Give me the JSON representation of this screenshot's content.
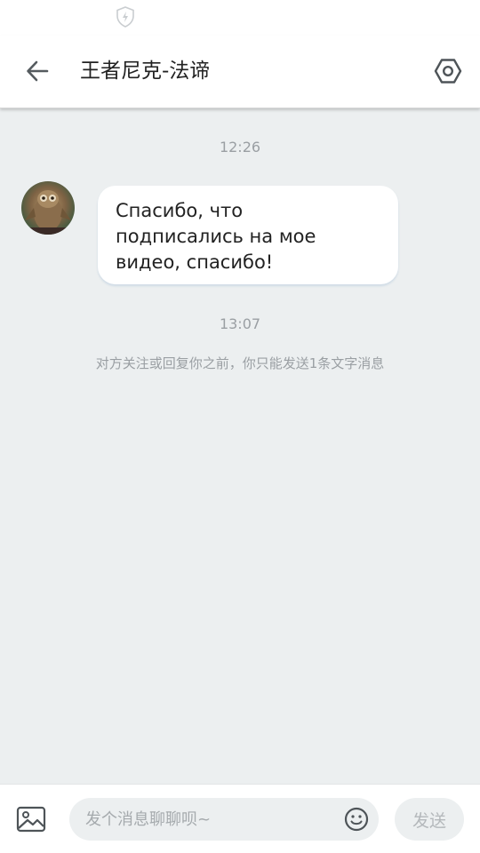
{
  "status_bar": {
    "icon": "shield-bolt-icon"
  },
  "header": {
    "back_icon": "arrow-left-icon",
    "title": "王者尼克-法谛",
    "settings_icon": "hexagon-settings-icon"
  },
  "messages": [
    {
      "time": "12:26",
      "sender": "other",
      "avatar": "owl-avatar",
      "lines": [
        "Спасибо, что",
        "подписались на мое",
        "видео, спасибо!"
      ]
    },
    {
      "time": "13:07",
      "system_notice": "对方关注或回复你之前，你只能发送1条文字消息"
    }
  ],
  "input_bar": {
    "image_icon": "image-icon",
    "placeholder": "发个消息聊聊呗~",
    "emoji_icon": "smiley-icon",
    "send_label": "发送"
  },
  "colors": {
    "background": "#eceff0",
    "header_bg": "#ffffff",
    "bubble_bg": "#ffffff",
    "muted_text": "#9a9fa3",
    "send_disabled_text": "#b4b8bb"
  }
}
